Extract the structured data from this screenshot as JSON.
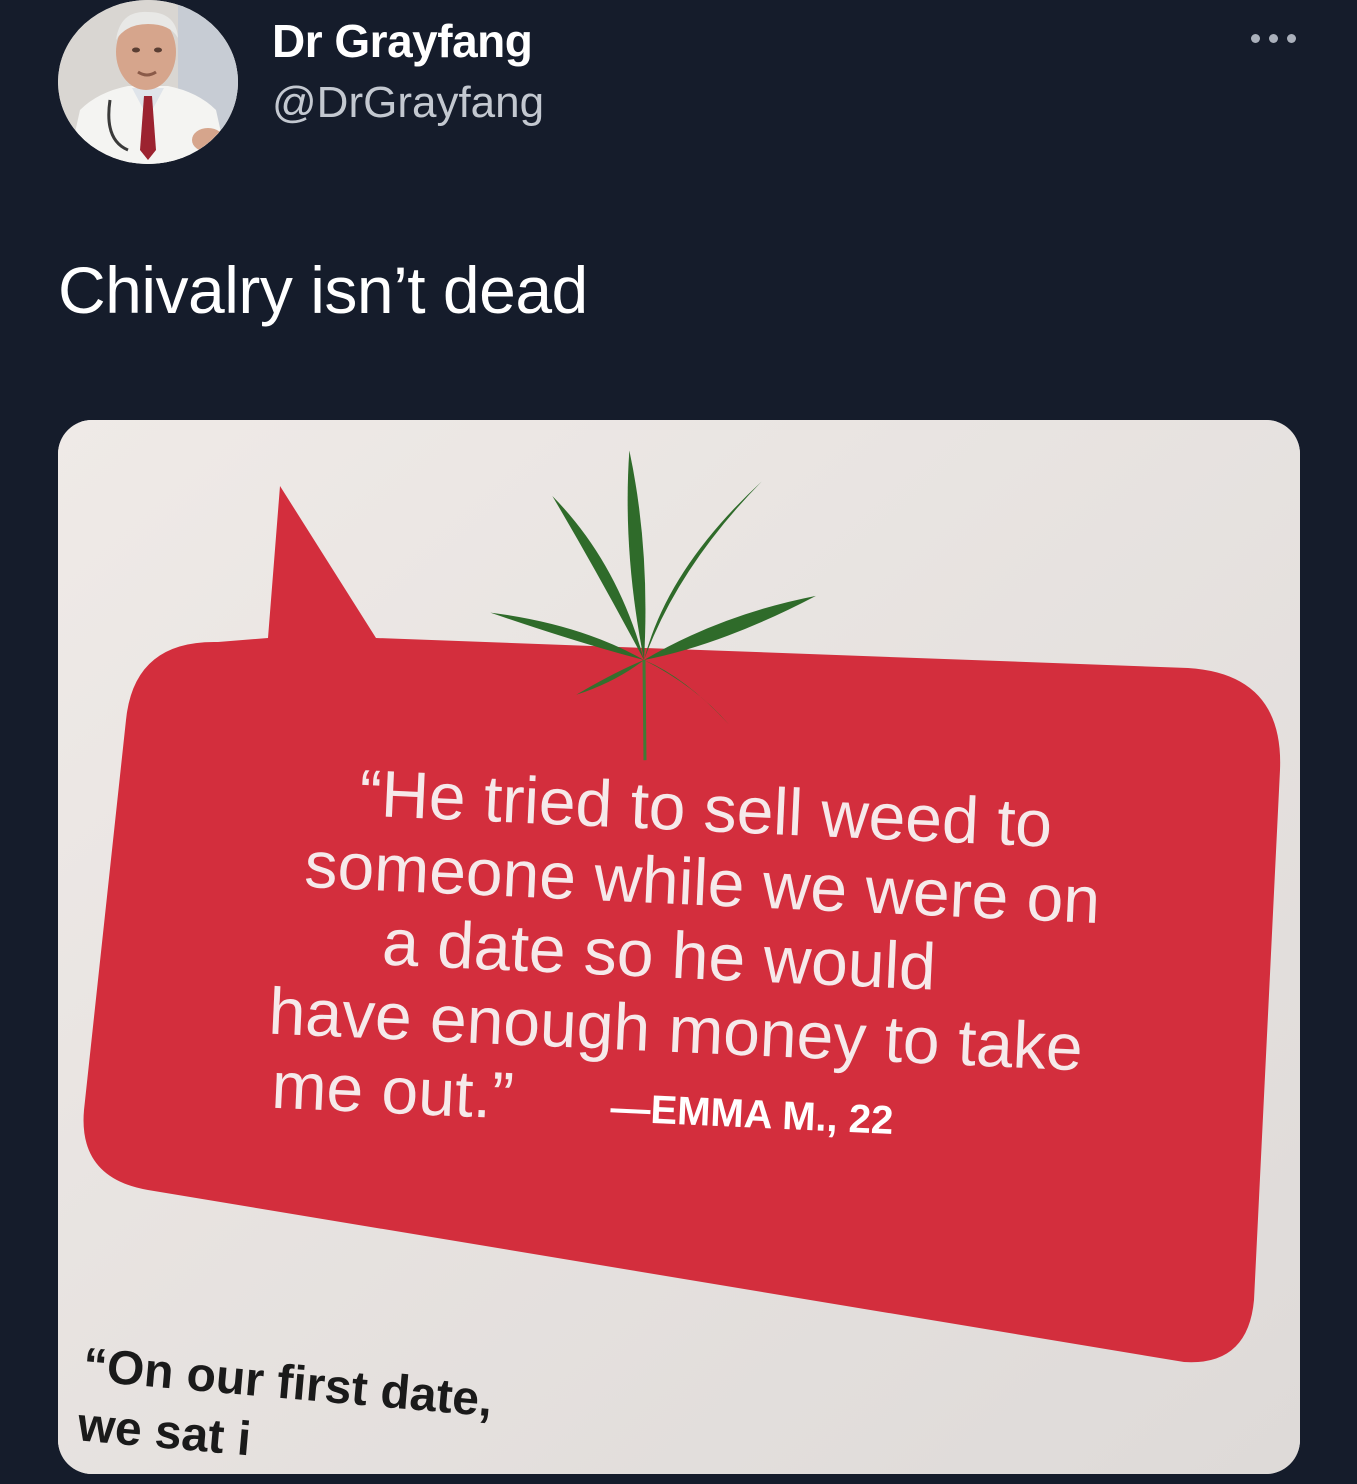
{
  "tweet": {
    "display_name": "Dr Grayfang",
    "handle": "@DrGrayfang",
    "text": "Chivalry isn’t dead"
  },
  "media": {
    "quote_lines": [
      "“He tried to sell weed to",
      "someone while we were on",
      "a date so he would",
      "have enough money to take",
      "me out.”"
    ],
    "attribution": "—EMMA M., 22",
    "next_quote_lines": [
      "“On our first date,",
      "we sat i"
    ]
  },
  "icons": {
    "more": "more-options-icon",
    "leaf": "cannabis-leaf-icon"
  },
  "colors": {
    "background": "#151c2b",
    "bubble": "#d32e3d",
    "paper": "#eae6e3",
    "leaf": "#2f6b2a"
  }
}
